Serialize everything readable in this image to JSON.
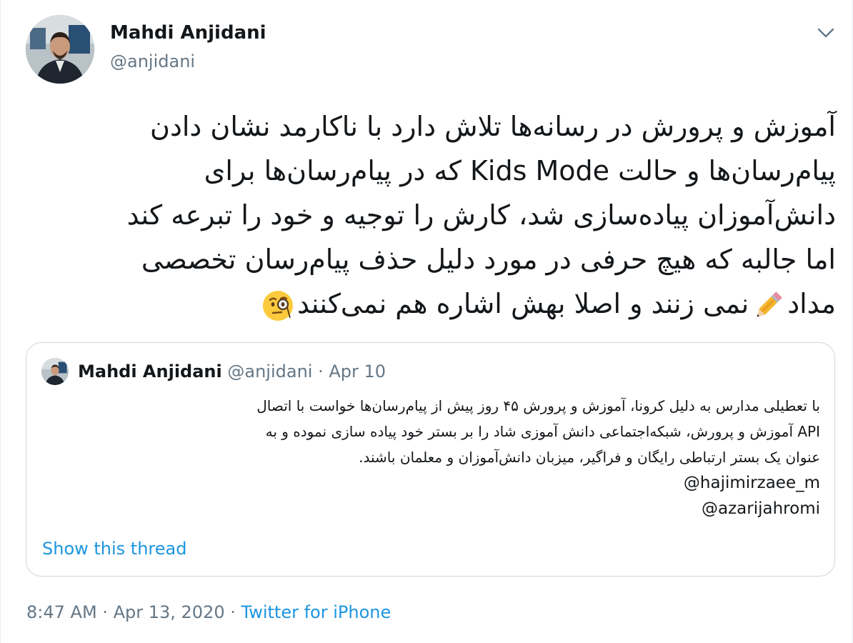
{
  "author": {
    "name": "Mahdi Anjidani",
    "handle": "@anjidani"
  },
  "tweet": {
    "lines": [
      "آموزش و پرورش در رسانه‌ها تلاش دارد با ناکارمد نشان دادن",
      "پیام‌رسان‌ها و حالت Kids Mode که در پیام‌رسان‌ها برای",
      "دانش‌آموزان پیاده‌سازی شد، کارش را توجیه و خود را تبرعه کند",
      "اما جالبه که هیچ حرفی در مورد دلیل حذف پیام‌رسان تخصصی",
      "مداد",
      "نمی زنند و اصلا بهش اشاره هم نمی‌کنند"
    ],
    "emojis": [
      "pencil-icon",
      "face-with-monocle-icon"
    ]
  },
  "quote": {
    "name": "Mahdi Anjidani",
    "handle": "@anjidani",
    "separator": "·",
    "date": "Apr 10",
    "lines": [
      "با تعطیلی مدارس به دلیل کرونا، آموزش و پرورش ۴۵ روز پیش از پیام‌رسان‌ها خواست با اتصال",
      "API آموزش و پرورش، شبکه‌اجتماعی دانش آموزی شاد را بر بستر خود پیاده سازی نموده و به",
      "عنوان یک بستر ارتباطی رایگان و فراگیر، میزبان دانش‌آموزان و معلمان باشند."
    ],
    "mentions": [
      "@hajimirzaee_m",
      "@azarijahromi"
    ],
    "show_thread": "Show this thread"
  },
  "footer": {
    "time": "8:47 AM",
    "separator": "·",
    "date": "Apr 13, 2020",
    "separator2": "·",
    "source": "Twitter for iPhone"
  },
  "colors": {
    "text": "#14171a",
    "secondary": "#657786",
    "link": "#1b95e0",
    "border": "#ccd6dd"
  }
}
